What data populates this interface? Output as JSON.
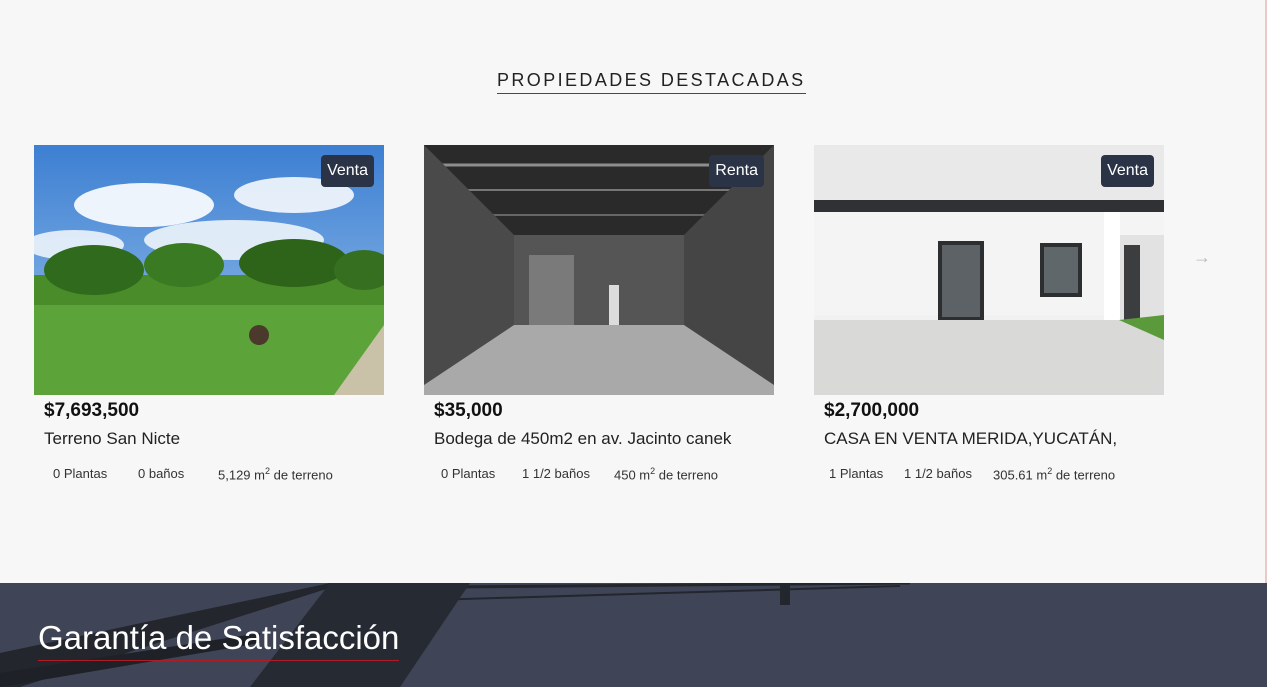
{
  "section": {
    "title": "PROPIEDADES DESTACADAS"
  },
  "properties": [
    {
      "badge": "Venta",
      "price": "$7,693,500",
      "title": "Terreno San Nicte",
      "floors": "0 Plantas",
      "baths": "0 baños",
      "area_value": "5,129 m",
      "area_exp": "2",
      "area_suffix": " de terreno"
    },
    {
      "badge": "Renta",
      "price": "$35,000",
      "title": "Bodega de 450m2 en av. Jacinto canek",
      "floors": "0 Plantas",
      "baths": "1 1/2 baños",
      "area_value": "450 m",
      "area_exp": "2",
      "area_suffix": " de terreno"
    },
    {
      "badge": "Venta",
      "price": "$2,700,000",
      "title": "CASA EN VENTA MERIDA,YUCATÁN,",
      "floors": "1 Plantas",
      "baths": "1 1/2 baños",
      "area_value": "305.61 m",
      "area_exp": "2",
      "area_suffix": " de terreno"
    }
  ],
  "carousel": {
    "next_icon": "arrow-right-icon"
  },
  "banner": {
    "title": "Garantía de Satisfacción"
  },
  "colors": {
    "accent": "#b01c24",
    "badge_bg": "#2b3447",
    "banner_bg": "#3f4556"
  }
}
